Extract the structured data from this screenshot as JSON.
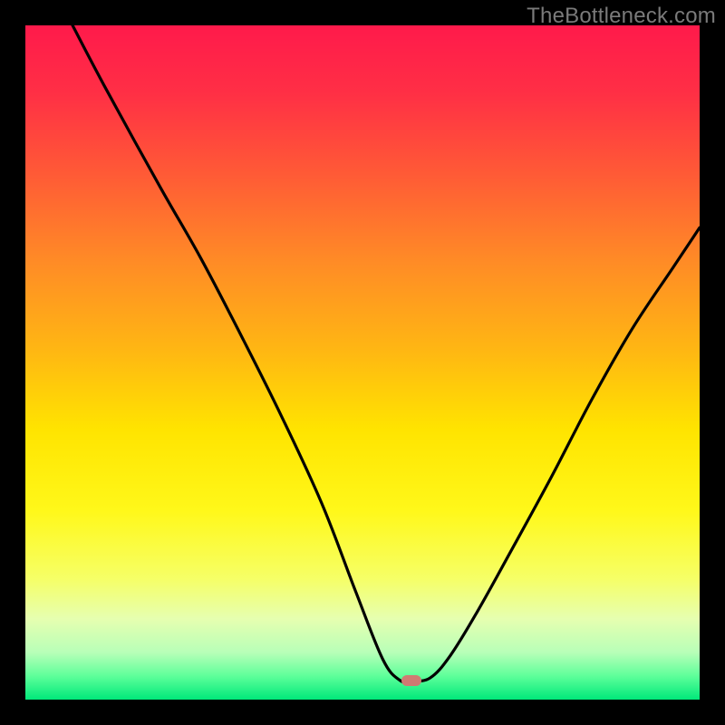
{
  "watermark": "TheBottleneck.com",
  "gradient": {
    "stops": [
      {
        "offset": 0.0,
        "color": "#ff1a4b"
      },
      {
        "offset": 0.1,
        "color": "#ff2f45"
      },
      {
        "offset": 0.22,
        "color": "#ff5a36"
      },
      {
        "offset": 0.35,
        "color": "#ff8b26"
      },
      {
        "offset": 0.48,
        "color": "#ffb613"
      },
      {
        "offset": 0.6,
        "color": "#ffe400"
      },
      {
        "offset": 0.72,
        "color": "#fff81a"
      },
      {
        "offset": 0.82,
        "color": "#f6ff66"
      },
      {
        "offset": 0.88,
        "color": "#e6ffb0"
      },
      {
        "offset": 0.93,
        "color": "#b8ffb8"
      },
      {
        "offset": 0.965,
        "color": "#5eff9a"
      },
      {
        "offset": 1.0,
        "color": "#00e87a"
      }
    ]
  },
  "marker": {
    "color": "#d07a72",
    "x_frac": 0.572,
    "y_frac": 0.972
  },
  "chart_data": {
    "type": "line",
    "title": "",
    "xlabel": "",
    "ylabel": "",
    "xlim": [
      0,
      100
    ],
    "ylim": [
      0,
      100
    ],
    "series": [
      {
        "name": "curve",
        "x": [
          7,
          12,
          20,
          26,
          32,
          38,
          44,
          49,
          53,
          55.5,
          57.2,
          60,
          63,
          67,
          72,
          78,
          84,
          90,
          96,
          100
        ],
        "y": [
          100,
          90.5,
          76,
          65.5,
          54,
          42,
          29,
          16,
          6,
          2.9,
          2.8,
          3.2,
          6.5,
          13,
          22,
          33,
          44.5,
          55,
          64,
          70
        ]
      }
    ]
  }
}
